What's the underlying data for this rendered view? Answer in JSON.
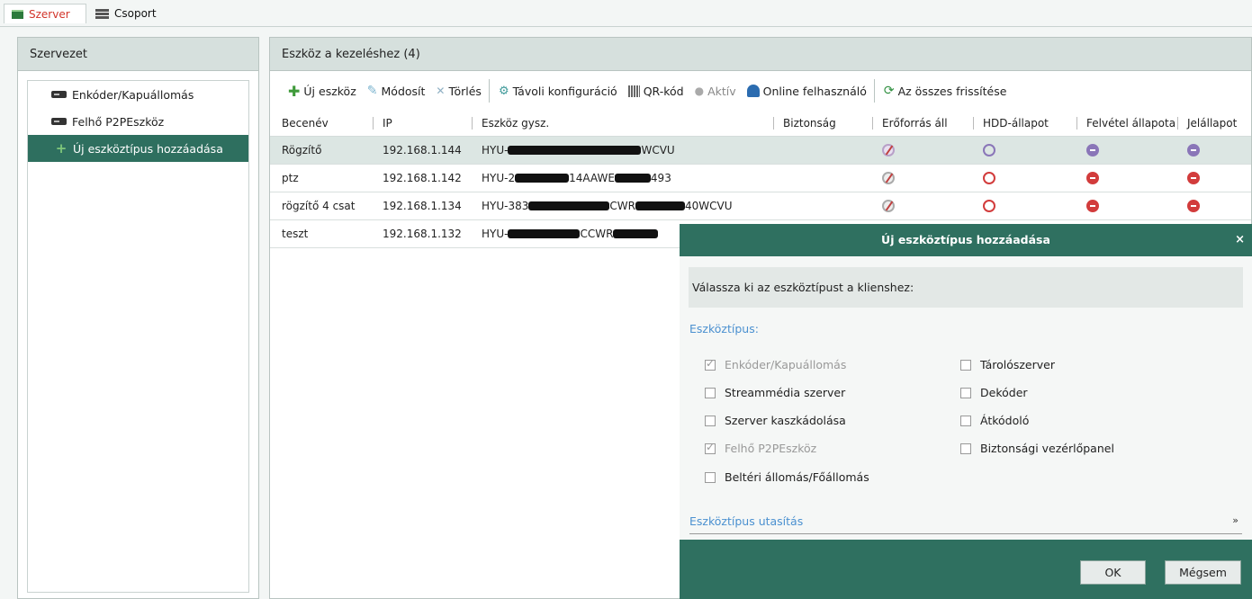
{
  "top_tabs": {
    "server": "Szerver",
    "group": "Csoport"
  },
  "left_panel": {
    "title": "Szervezet",
    "items": [
      {
        "label": "Enkóder/Kapuállomás"
      },
      {
        "label": "Felhő P2PEszköz"
      },
      {
        "label": "Új eszköztípus hozzáadása"
      }
    ]
  },
  "right_panel": {
    "title": "Eszköz a kezeléshez (4)",
    "toolbar": {
      "add": "Új eszköz",
      "modify": "Módosít",
      "delete": "Törlés",
      "remote_config": "Távoli konfiguráció",
      "qr": "QR-kód",
      "active": "Aktív",
      "online_user": "Online felhasználó",
      "refresh_all": "Az összes frissítése"
    },
    "columns": [
      "Becenév",
      "IP",
      "Eszköz gysz.",
      "Biztonság",
      "Erőforrás áll",
      "HDD-állapot",
      "Felvétel állapota",
      "Jelállapot"
    ],
    "rows": [
      {
        "name": "Rögzítő",
        "ip": "192.168.1.144",
        "serial_prefix": "HYU-",
        "serial_suffix": "WCVU"
      },
      {
        "name": "ptz",
        "ip": "192.168.1.142",
        "serial_prefix": "HYU-2",
        "serial_suffix": "493"
      },
      {
        "name": "rögzítő 4 csat",
        "ip": "192.168.1.134",
        "serial_prefix": "HYU-383",
        "serial_suffix": "40WCVU"
      },
      {
        "name": "teszt",
        "ip": "192.168.1.132",
        "serial_prefix": "HYU-",
        "serial_suffix": ""
      }
    ]
  },
  "dialog": {
    "title": "Új eszköztípus hozzáadása",
    "close": "×",
    "prompt": "Válassza ki az eszköztípust a klienshez:",
    "section_label": "Eszköztípus:",
    "left_options": [
      {
        "label": "Enkóder/Kapuállomás",
        "checked": true,
        "disabled": true
      },
      {
        "label": "Streammédia szerver",
        "checked": false,
        "disabled": false
      },
      {
        "label": "Szerver kaszkádolása",
        "checked": false,
        "disabled": false
      },
      {
        "label": "Felhő P2PEszköz",
        "checked": true,
        "disabled": true
      },
      {
        "label": "Beltéri állomás/Főállomás",
        "checked": false,
        "disabled": false
      }
    ],
    "right_options": [
      {
        "label": "Tárolószerver",
        "checked": false
      },
      {
        "label": "Dekóder",
        "checked": false
      },
      {
        "label": "Átkódoló",
        "checked": false
      },
      {
        "label": "Biztonsági vezérlőpanel",
        "checked": false
      }
    ],
    "instructions_label": "Eszköztípus utasítás",
    "instructions_chevron": "»",
    "ok": "OK",
    "cancel": "Mégsem"
  }
}
